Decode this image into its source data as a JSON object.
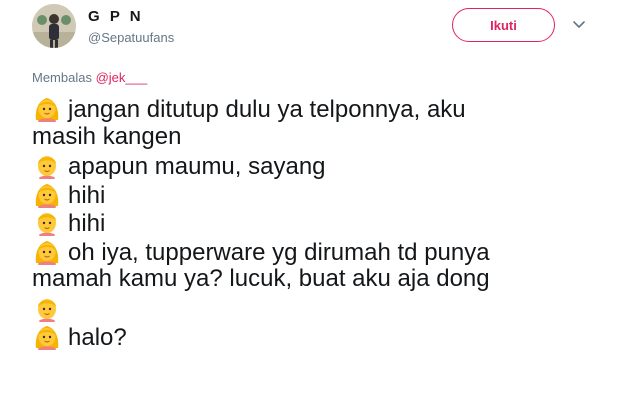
{
  "header": {
    "display_name": "G P N",
    "handle": "@Sepatuufans",
    "follow_label": "Ikuti",
    "accent_color": "#e0245e"
  },
  "replying": {
    "label": "Membalas",
    "mention": "@jek___"
  },
  "tweet": {
    "lines": [
      {
        "emoji": "girl-emoji",
        "text": "jangan ditutup dulu ya telponnya, aku"
      },
      {
        "emoji": "",
        "text": "masih kangen"
      },
      {
        "emoji": "boy-emoji",
        "text": "apapun maumu, sayang"
      },
      {
        "emoji": "girl-emoji",
        "text": "hihi"
      },
      {
        "emoji": "boy-emoji",
        "text": "hihi"
      },
      {
        "emoji": "girl-emoji",
        "text": "oh iya, tupperware yg dirumah td punya"
      },
      {
        "emoji": "",
        "text": "mamah kamu ya? lucuk, buat aku aja dong"
      },
      {
        "emoji": "boy-emoji",
        "text": ""
      },
      {
        "emoji": "girl-emoji",
        "text": "halo?"
      }
    ]
  }
}
